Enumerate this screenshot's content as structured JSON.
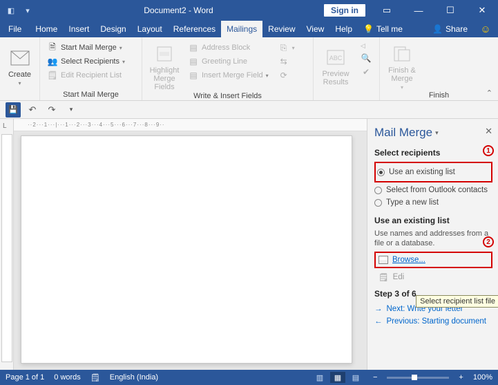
{
  "titlebar": {
    "title": "Document2 - Word",
    "signin": "Sign in"
  },
  "tabs": {
    "file": "File",
    "items": [
      "Home",
      "Insert",
      "Design",
      "Layout",
      "References",
      "Mailings",
      "Review",
      "View",
      "Help"
    ],
    "active_index": 5,
    "tell_me": "Tell me",
    "share": "Share"
  },
  "ribbon": {
    "create": {
      "label": "Create",
      "group": "Create"
    },
    "start_group": {
      "start": "Start Mail Merge",
      "select": "Select Recipients",
      "edit": "Edit Recipient List",
      "label": "Start Mail Merge"
    },
    "write_group": {
      "highlight": "Highlight Merge Fields",
      "addr": "Address Block",
      "greet": "Greeting Line",
      "insert": "Insert Merge Field",
      "label": "Write & Insert Fields"
    },
    "preview_group": {
      "preview": "Preview Results"
    },
    "finish_group": {
      "finish": "Finish & Merge",
      "label": "Finish"
    }
  },
  "ruler_h": "··2···1···|···1···2···3···4···5···6···7···8···9··",
  "pane": {
    "title": "Mail Merge",
    "sect_recipients": "Select recipients",
    "opt_existing": "Use an existing list",
    "opt_outlook": "Select from Outlook contacts",
    "opt_new": "Type a new list",
    "sect_use": "Use an existing list",
    "desc": "Use names and addresses from a file or a database.",
    "browse": "Browse...",
    "edit": "Edi",
    "tooltip": "Select recipient list file",
    "step": "Step 3 of 6",
    "next": "Next: Write your letter",
    "prev": "Previous: Starting document",
    "marker1": "1",
    "marker2": "2"
  },
  "status": {
    "page": "Page 1 of 1",
    "words": "0 words",
    "lang": "English (India)",
    "zoom_minus": "−",
    "zoom_plus": "+",
    "zoom": "100%"
  }
}
